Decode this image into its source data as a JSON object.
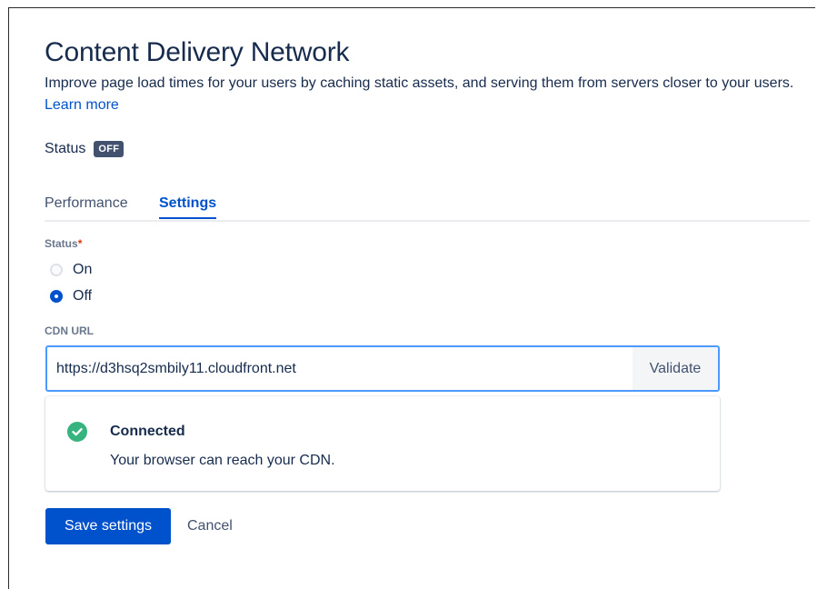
{
  "page": {
    "title": "Content Delivery Network",
    "description": "Improve page load times for your users by caching static assets, and serving them from servers closer to your users.",
    "learn_more": "Learn more"
  },
  "status": {
    "label": "Status",
    "badge": "OFF"
  },
  "tabs": [
    {
      "label": "Performance",
      "active": false
    },
    {
      "label": "Settings",
      "active": true
    }
  ],
  "form": {
    "status_label": "Status",
    "required_marker": "*",
    "options": [
      {
        "label": "On",
        "selected": false
      },
      {
        "label": "Off",
        "selected": true
      }
    ],
    "cdn_url_label": "CDN URL",
    "cdn_url_value": "https://d3hsq2smbily11.cloudfront.net",
    "validate_label": "Validate"
  },
  "result": {
    "icon": "check-circle-icon",
    "title": "Connected",
    "message": "Your browser can reach your CDN."
  },
  "actions": {
    "save_label": "Save settings",
    "cancel_label": "Cancel"
  },
  "colors": {
    "primary": "#0052cc",
    "text": "#172b4d",
    "success": "#36b37e",
    "lozenge": "#42526e",
    "required": "#de350b"
  }
}
